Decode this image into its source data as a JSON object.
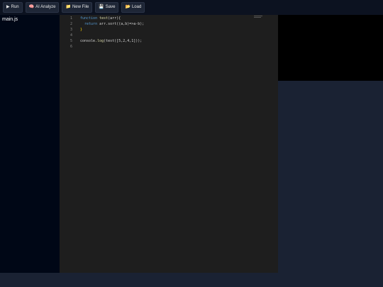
{
  "toolbar": {
    "buttons": [
      {
        "icon": "play-icon",
        "glyph": "▶",
        "label": "Run"
      },
      {
        "icon": "brain-icon",
        "glyph": "🧠",
        "label": "AI Analyze"
      },
      {
        "icon": "folder-icon",
        "glyph": "📁",
        "label": "New File"
      },
      {
        "icon": "save-icon",
        "glyph": "💾",
        "label": "Save"
      },
      {
        "icon": "folder-open-icon",
        "glyph": "📂",
        "label": "Load"
      }
    ]
  },
  "sidebar": {
    "files": [
      {
        "name": "main.js"
      }
    ]
  },
  "editor": {
    "line_numbers": [
      "1",
      "2",
      "3",
      "4",
      "5",
      "6"
    ],
    "lines": [
      {
        "t1": "function",
        "t2": " test",
        "t3": "(arr){"
      },
      {
        "t1": "  return",
        "t2": " arr.sort",
        "t3": "((a,b)=>a-b);"
      },
      {
        "t1": "}",
        "t2": "",
        "t3": ""
      },
      {
        "t1": "",
        "t2": "",
        "t3": ""
      },
      {
        "t1": "console",
        "t2": ".log",
        "t3": "(test([5,2,4,1]));"
      },
      {
        "t1": "",
        "t2": "",
        "t3": ""
      }
    ]
  },
  "colors": {
    "background": "#0c1220",
    "sidebar": "#000716",
    "editor": "#1e1e1e",
    "preview": "#000000",
    "panel": "#1a2233"
  }
}
